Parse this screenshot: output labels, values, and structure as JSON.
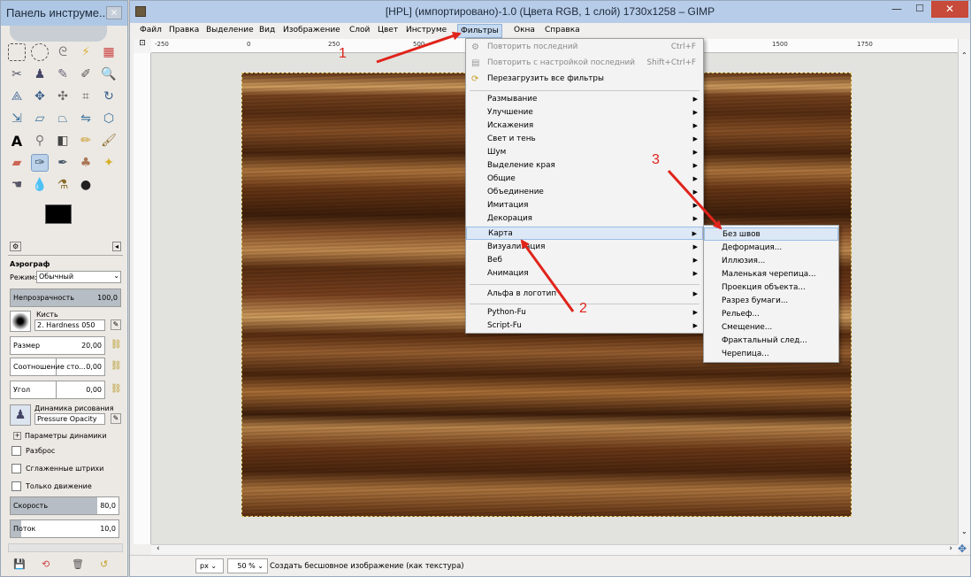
{
  "toolbox": {
    "title": "Панель инструме...",
    "close": "×",
    "tool_name": "Аэрограф",
    "mode_label": "Режим:",
    "mode_value": "Обычный",
    "opacity_label": "Непрозрачность",
    "opacity_value": "100,0",
    "opacity_fill": 1.0,
    "brush_label": "Кисть",
    "brush_value": "2. Hardness 050",
    "size_label": "Размер",
    "size_value": "20,00",
    "aspect_label": "Соотношение сто...",
    "aspect_value": "0,00",
    "angle_label": "Угол",
    "angle_value": "0,00",
    "dynamics_label": "Динамика рисования",
    "dynamics_value": "Pressure Opacity",
    "dynamics_params": "Параметры динамики",
    "scatter": "Разброс",
    "smooth": "Сглаженные штрихи",
    "motion_only": "Только движение",
    "rate_label": "Скорость",
    "rate_value": "80,0",
    "rate_fill": 0.8,
    "flow_label": "Поток",
    "flow_value": "10,0",
    "flow_fill": 0.1
  },
  "window": {
    "title": "[HPL] (импортировано)-1.0 (Цвета RGB, 1 слой) 1730x1258 – GIMP"
  },
  "menubar": [
    "Файл",
    "Правка",
    "Выделение",
    "Вид",
    "Изображение",
    "Слой",
    "Цвет",
    "Инструме",
    "Фильтры",
    "Окна",
    "Справка"
  ],
  "ruler": [
    "-250",
    "0",
    "250",
    "500",
    "1500",
    "1750"
  ],
  "filters_menu": {
    "top_items": [
      {
        "label": "Повторить последний",
        "shortcut": "Ctrl+F"
      },
      {
        "label": "Повторить с настройкой последний",
        "shortcut": "Shift+Ctrl+F"
      },
      {
        "label": "Перезагрузить все фильтры",
        "shortcut": ""
      }
    ],
    "groups": [
      "Размывание",
      "Улучшение",
      "Искажения",
      "Свет и тень",
      "Шум",
      "Выделение края",
      "Общие",
      "Объединение",
      "Имитация",
      "Декорация",
      "Карта",
      "Визуализация",
      "Веб",
      "Анимация"
    ],
    "alpha": "Альфа в логотип",
    "scripts": [
      "Python-Fu",
      "Script-Fu"
    ]
  },
  "map_submenu": [
    "Без швов",
    "Деформация...",
    "Иллюзия...",
    "Маленькая черепица...",
    "Проекция объекта...",
    "Разрез бумаги...",
    "Рельеф...",
    "Смещение...",
    "Фрактальный след...",
    "Черепица..."
  ],
  "annotations": [
    "1",
    "2",
    "3"
  ],
  "status": {
    "unit": "px",
    "zoom": "50 %",
    "message": "Создать бесшовное изображение (как текстура)"
  },
  "colors": {
    "arrow": "#e0241b",
    "highlight": "#dde8f6"
  }
}
